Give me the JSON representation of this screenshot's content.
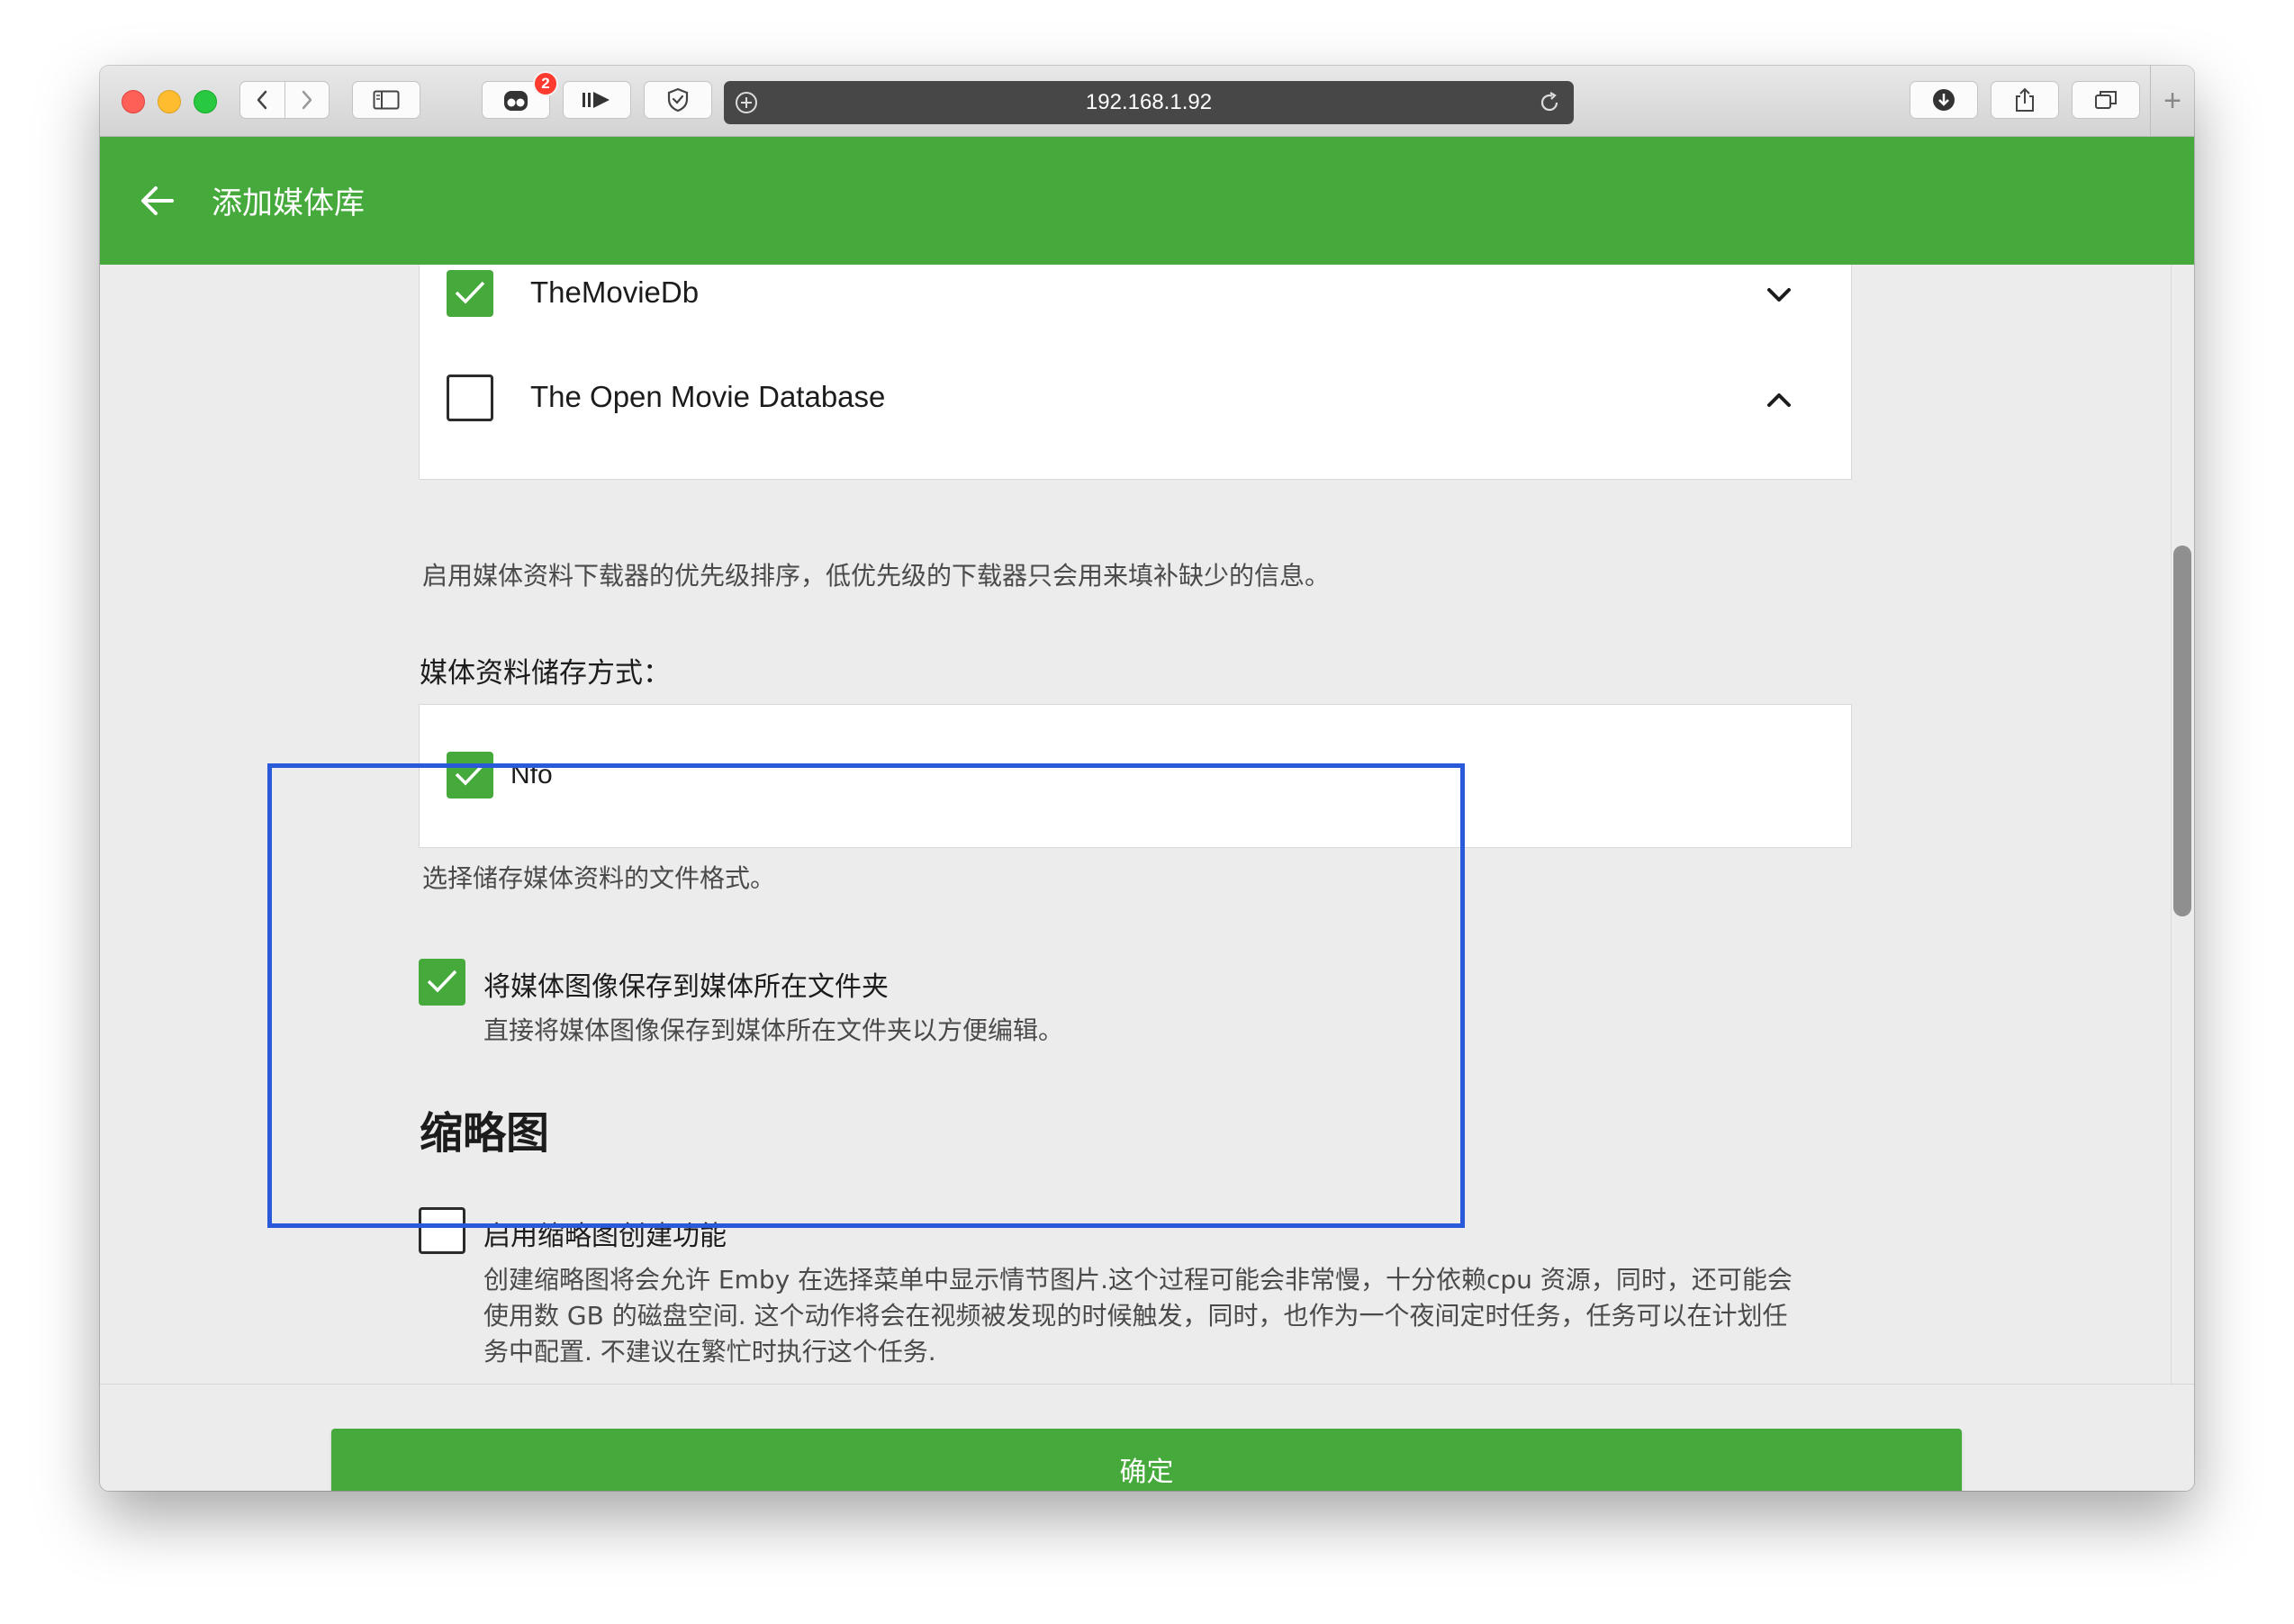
{
  "browser": {
    "address": "192.168.1.92",
    "tab_badge_count": "2",
    "new_tab_symbol": "+"
  },
  "header": {
    "title": "添加媒体库"
  },
  "metadata_downloaders": {
    "items": [
      {
        "label": "TheMovieDb",
        "checked": true,
        "chevron": "chevron-down-icon"
      },
      {
        "label": "The Open Movie Database",
        "checked": false,
        "chevron": "chevron-up-icon"
      }
    ],
    "help": "启用媒体资料下载器的优先级排序，低优先级的下载器只会用来填补缺少的信息。"
  },
  "metadata_savers": {
    "label": "媒体资料储存方式：",
    "items": [
      {
        "label": "Nfo",
        "checked": true
      }
    ],
    "help": "选择储存媒体资料的文件格式。"
  },
  "save_artwork": {
    "label": "将媒体图像保存到媒体所在文件夹",
    "checked": true,
    "help": "直接将媒体图像保存到媒体所在文件夹以方便编辑。"
  },
  "thumbnails": {
    "heading": "缩略图",
    "option_label": "启用缩略图创建功能",
    "checked": false,
    "help_line1": "创建缩略图将会允许 Emby 在选择菜单中显示情节图片.这个过程可能会非常慢，十分依赖cpu 资源，同时，还可能会",
    "help_line2": "使用数 GB 的磁盘空间. 这个动作将会在视频被发现的时候触发，同时，也作为一个夜间定时任务，任务可以在计划任",
    "help_line3": "务中配置. 不建议在繁忙时执行这个任务."
  },
  "footer": {
    "confirm_label": "确定"
  },
  "colors": {
    "accent_green": "#46a93b",
    "highlight_blue": "#2a5ad9"
  }
}
